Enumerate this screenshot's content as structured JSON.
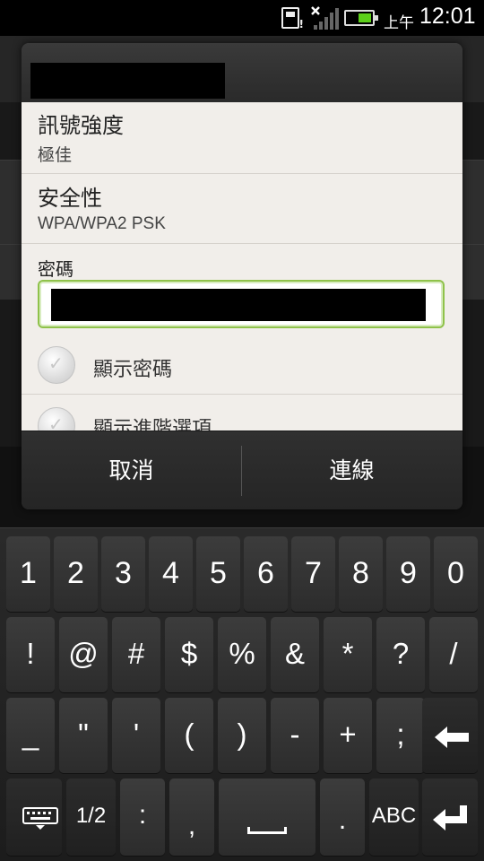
{
  "status_bar": {
    "ampm": "上午",
    "time": "12:01",
    "battery_color": "#5ccf1a"
  },
  "dialog": {
    "title": "",
    "signal": {
      "label": "訊號強度",
      "value": "極佳"
    },
    "security": {
      "label": "安全性",
      "value": "WPA/WPA2 PSK"
    },
    "password": {
      "label": "密碼",
      "value": ""
    },
    "show_password": {
      "label": "顯示密碼",
      "checked": false
    },
    "advanced_options": {
      "label": "顯示進階選項",
      "checked": false
    },
    "buttons": {
      "cancel": "取消",
      "connect": "連線"
    }
  },
  "keyboard": {
    "row1": [
      "1",
      "2",
      "3",
      "4",
      "5",
      "6",
      "7",
      "8",
      "9",
      "0"
    ],
    "row2": [
      "!",
      "@",
      "#",
      "$",
      "%",
      "&",
      "*",
      "?",
      "/"
    ],
    "row3": [
      "_",
      "\"",
      "'",
      "(",
      ")",
      "-",
      "+",
      ";"
    ],
    "row4": {
      "page": "1/2",
      "colon": ":",
      "comma": ",",
      "period": ".",
      "abc": "ABC"
    },
    "icons": [
      "keyboard-settings-icon",
      "backspace-icon",
      "space-icon",
      "enter-icon"
    ]
  }
}
